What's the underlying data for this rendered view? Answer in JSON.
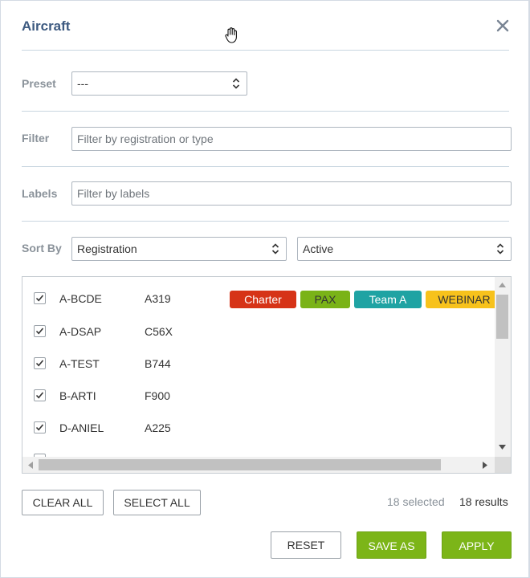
{
  "dialog": {
    "title": "Aircraft",
    "close_icon": "close-icon",
    "cursor_icon": "hand-cursor-icon"
  },
  "preset": {
    "label": "Preset",
    "value": "---"
  },
  "filter": {
    "label": "Filter",
    "placeholder": "Filter by registration or type"
  },
  "labels": {
    "label": "Labels",
    "placeholder": "Filter by labels"
  },
  "sort": {
    "label": "Sort By",
    "field_value": "Registration",
    "status_value": "Active"
  },
  "aircraft": [
    {
      "registration": "A-BCDE",
      "type": "A319",
      "checked": true
    },
    {
      "registration": "A-DSAP",
      "type": "C56X",
      "checked": true
    },
    {
      "registration": "A-TEST",
      "type": "B744",
      "checked": true
    },
    {
      "registration": "B-ARTI",
      "type": "F900",
      "checked": true
    },
    {
      "registration": "D-ANIEL",
      "type": "A225",
      "checked": true
    }
  ],
  "tags": [
    {
      "text": "Charter",
      "color": "#d63317",
      "text_color": "#ffffff"
    },
    {
      "text": "PAX",
      "color": "#7ab317",
      "text_color": "#333333"
    },
    {
      "text": "Team A",
      "color": "#1fa3a3",
      "text_color": "#ffffff"
    },
    {
      "text": "WEBINAR",
      "color": "#f7c21c",
      "text_color": "#333333"
    }
  ],
  "actions": {
    "clear_all": "CLEAR ALL",
    "select_all": "SELECT ALL",
    "selected_count": "18 selected",
    "results_count": "18 results",
    "reset": "RESET",
    "save_as": "SAVE AS",
    "apply": "APPLY"
  },
  "colors": {
    "title": "#3d5a80",
    "accent_green": "#7cb518"
  }
}
